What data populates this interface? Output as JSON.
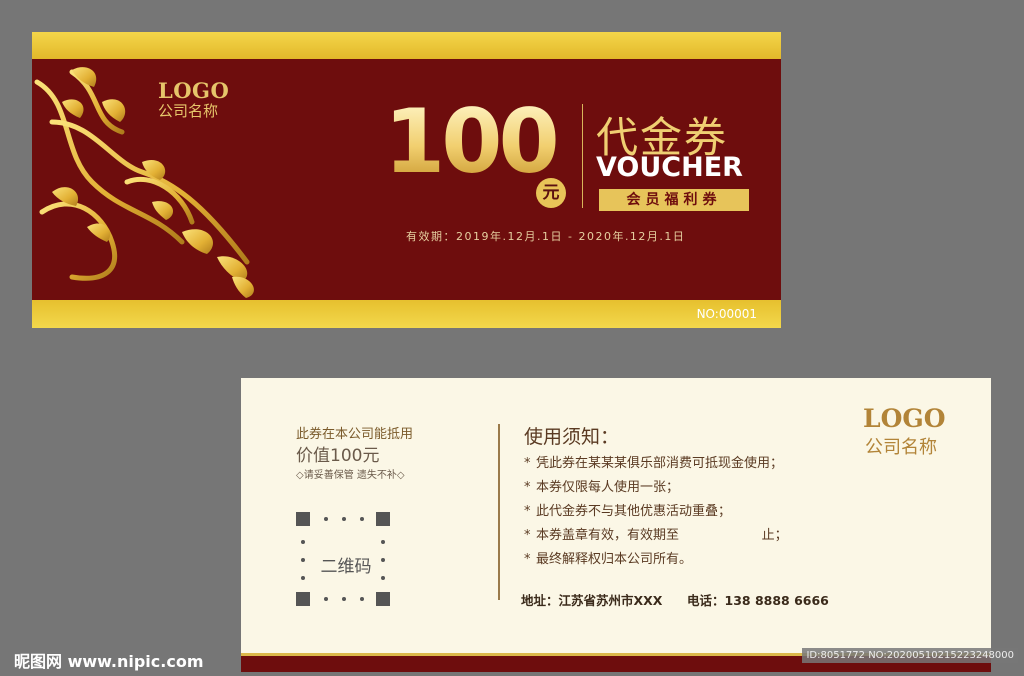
{
  "front": {
    "logo": "LOGO",
    "company": "公司名称",
    "amount": "100",
    "unit": "元",
    "title_cn": "代金券",
    "title_en": "VOUCHER",
    "member_label": "会员福利券",
    "validity": "有效期：2019年.12月.1日 - 2020年.12月.1日",
    "serial": "NO:00001",
    "colors": {
      "burgundy": "#6e0d0d",
      "gold": "#e7c45a"
    }
  },
  "back": {
    "left_line1": "此券在本公司能抵用",
    "left_line2": "价值100元",
    "left_note": "◇请妥善保管 遗失不补◇",
    "qr_label": "二维码",
    "notice_title": "使用须知：",
    "rules": [
      "凭此券在某某某俱乐部消费可抵现金使用；",
      "本券仅限每人使用一张；",
      "此代金券不与其他优惠活动重叠；",
      "本券盖章有效，有效期至                    止；",
      "最终解释权归本公司所有。"
    ],
    "bullet": "*",
    "address": "地址：江苏省苏州市XXX",
    "phone": "电话：138 8888 6666",
    "logo": "LOGO",
    "company": "公司名称"
  },
  "watermark": {
    "site": "昵图网 www.nipic.com",
    "id": "ID:8051772 NO:20200510215223248000"
  }
}
